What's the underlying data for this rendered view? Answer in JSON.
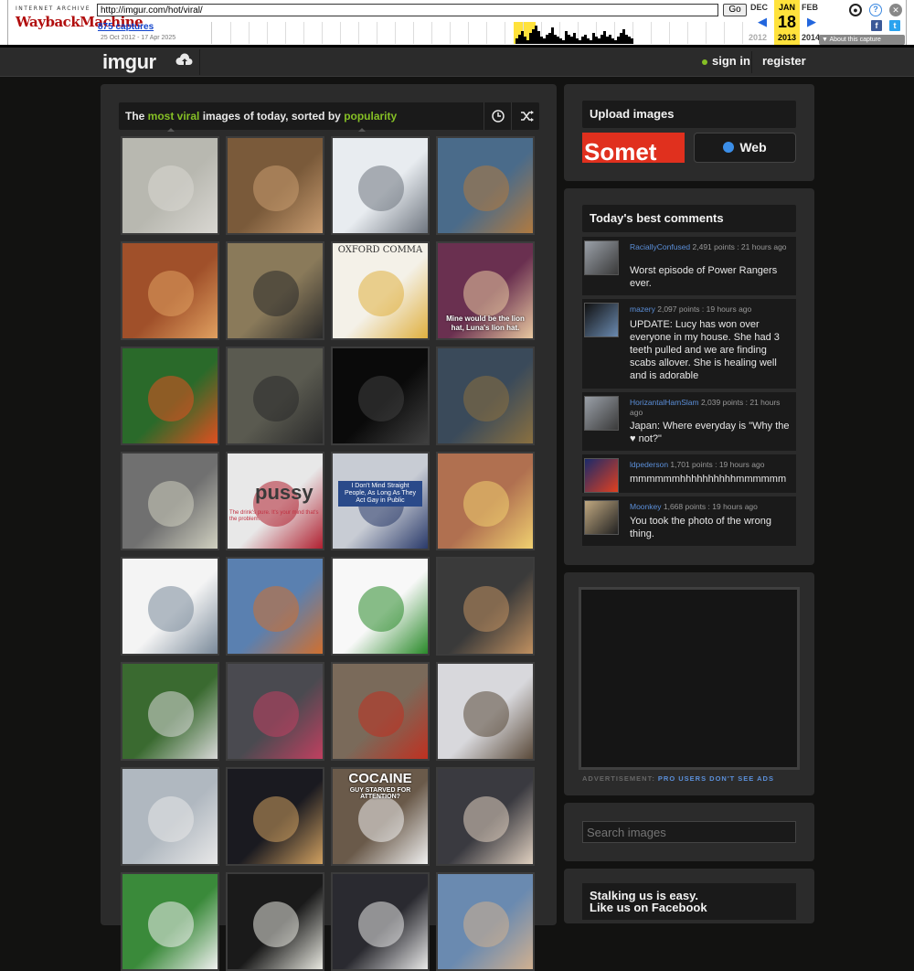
{
  "wayback": {
    "logo_top": "INTERNET ARCHIVE",
    "logo_main": "WaybackMachine",
    "url": "http://imgur.com/hot/viral/",
    "go": "Go",
    "captures": "875 captures",
    "range": "25 Oct 2012 - 17 Apr 2025",
    "prev_month": "DEC",
    "cur_month": "JAN",
    "next_month": "FEB",
    "cur_day": "18",
    "prev_year": "2012",
    "cur_year": "2013",
    "next_year": "2014",
    "about": "▼ About this capture"
  },
  "header": {
    "logo": "imgur",
    "signin": "sign in",
    "register": "register"
  },
  "gallery": {
    "title_pre": "The ",
    "title_hl1": "most viral",
    "title_mid": " images of today, sorted by ",
    "title_hl2": "popularity",
    "thumbs": [
      {
        "bg": "#b8b8b0",
        "fg": "#d9d7d2"
      },
      {
        "bg": "#7a5a3a",
        "fg": "#c89c70"
      },
      {
        "bg": "#e8ecf0",
        "fg": "#6f7680"
      },
      {
        "bg": "#4a6b8a",
        "fg": "#b07a40"
      },
      {
        "bg": "#a0502a",
        "fg": "#e0a060"
      },
      {
        "bg": "#8a7a5a",
        "fg": "#2a2a2a"
      },
      {
        "bg": "#f4f1e8",
        "fg": "#e0b040"
      },
      {
        "bg": "#6a3050",
        "fg": "#e8c8a0"
      },
      {
        "bg": "#2a6a2a",
        "fg": "#e05020"
      },
      {
        "bg": "#5a5a50",
        "fg": "#2a2a2a"
      },
      {
        "bg": "#0a0a0a",
        "fg": "#404040"
      },
      {
        "bg": "#3a4a5a",
        "fg": "#8a7040"
      },
      {
        "bg": "#707070",
        "fg": "#d0d0c0"
      },
      {
        "bg": "#e8e8e8",
        "fg": "#b02030"
      },
      {
        "bg": "#c8ccd4",
        "fg": "#2a3a6a"
      },
      {
        "bg": "#b07050",
        "fg": "#f0d070"
      },
      {
        "bg": "#f4f4f4",
        "fg": "#7a8a9a"
      },
      {
        "bg": "#5a80b0",
        "fg": "#d07030"
      },
      {
        "bg": "#f8f8f8",
        "fg": "#2a8a2a"
      },
      {
        "bg": "#3a3a3a",
        "fg": "#c09060"
      },
      {
        "bg": "#3a6a30",
        "fg": "#d8d8d8"
      },
      {
        "bg": "#4a4a50",
        "fg": "#c04060"
      },
      {
        "bg": "#7a6a5a",
        "fg": "#c03020"
      },
      {
        "bg": "#d8d8dc",
        "fg": "#5a4a3a"
      },
      {
        "bg": "#b0b8c0",
        "fg": "#e8e8e8"
      },
      {
        "bg": "#1a1a20",
        "fg": "#d0a060"
      },
      {
        "bg": "#6a5a4a",
        "fg": "#f0f0f0"
      },
      {
        "bg": "#3a3a40",
        "fg": "#e0d0c0"
      },
      {
        "bg": "#3a8a3a",
        "fg": "#f0f0f0"
      },
      {
        "bg": "#1a1a1a",
        "fg": "#e8e8e0"
      },
      {
        "bg": "#2a2a30",
        "fg": "#e8e8e8"
      },
      {
        "bg": "#6a8ab0",
        "fg": "#d0b090"
      }
    ],
    "captions": {
      "t2": "OXFORD COMMA",
      "t7": "Mine would be the lion hat, Luna's lion hat.",
      "t13": "pussy",
      "t13b": "The drink's pure. It's your mind that's the problem.",
      "t14": "I Don't Mind Straight People, As Long As They Act Gay in Public",
      "t25": "COCAINE",
      "t25b": "GUY STARVED FOR ATTENTION?"
    }
  },
  "upload": {
    "title": "Upload images",
    "preview": "Somet",
    "web": "Web"
  },
  "comments": {
    "title": "Today's best comments",
    "items": [
      {
        "user": "RaciallyConfused",
        "meta": " 2,491 points : 21 hours ago",
        "text": "Worst episode of Power Rangers ever."
      },
      {
        "user": "mazery",
        "meta": " 2,097 points : 19 hours ago",
        "text": "UPDATE: Lucy has won over everyone in my house. She had 3 teeth pulled and we are finding scabs allover. She is healing well and is adorable"
      },
      {
        "user": "HorizantalHamSlam",
        "meta": " 2,039 points : 21 hours ago",
        "text": "Japan: Where everyday is \"Why the ♥ not?\""
      },
      {
        "user": "ldpederson",
        "meta": " 1,701 points : 19 hours ago",
        "text": "mmmmmmhhhhhhhhhhmmmmmm"
      },
      {
        "user": "Moonkey",
        "meta": " 1,668 points : 19 hours ago",
        "text": "You took the photo of the wrong thing."
      }
    ]
  },
  "ad": {
    "label": "ADVERTISEMENT: ",
    "link": "PRO USERS DON'T SEE ADS"
  },
  "search": {
    "placeholder": "Search images"
  },
  "facebook": {
    "line1": "Stalking us is easy.",
    "line2": "Like us on Facebook"
  }
}
